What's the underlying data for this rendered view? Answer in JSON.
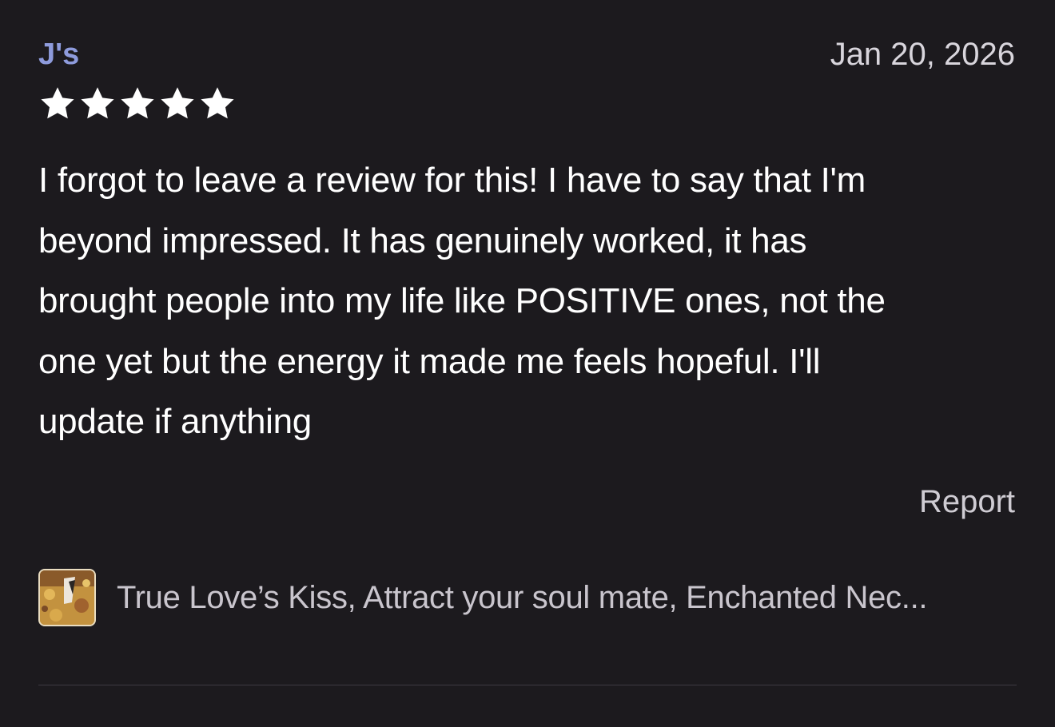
{
  "review": {
    "reviewer": "J's",
    "date": "Jan 20, 2026",
    "rating": 5,
    "rating_max": 5,
    "text": "I forgot to leave a review for this! I have to say that I'm\nbeyond impressed. It has genuinely worked, it has\nbrought people into my life like POSITIVE ones, not the\none yet but the energy it made me feels hopeful. I'll\nupdate if anything",
    "report_label": "Report"
  },
  "product": {
    "title": "True Love’s Kiss, Attract your soul mate, Enchanted Nec..."
  },
  "colors": {
    "background": "#1c1a1e",
    "reviewer_name": "#8e9bdc",
    "star": "#ffffff",
    "divider": "#3d3a42"
  }
}
